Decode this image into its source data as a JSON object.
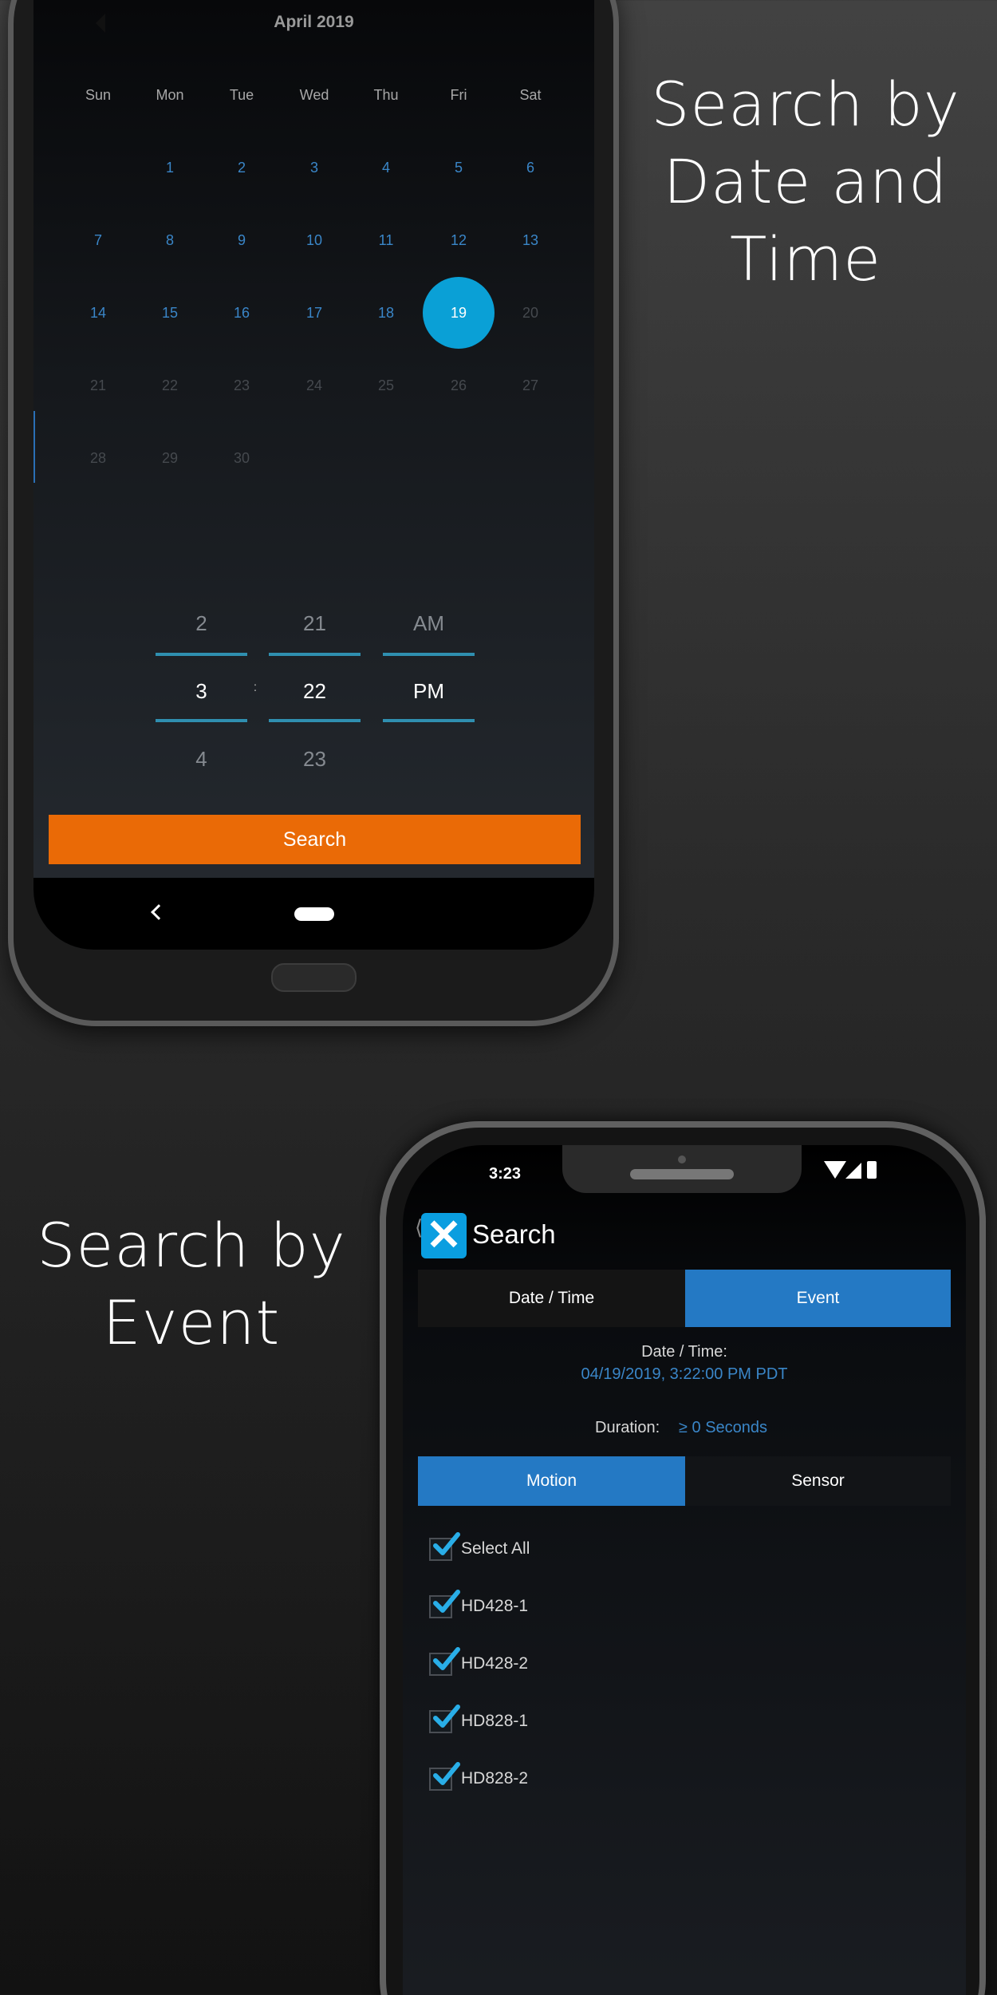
{
  "headlines": {
    "top": [
      "Search by",
      "Date and",
      "Time"
    ],
    "bottom": [
      "Search by",
      "Event"
    ]
  },
  "colors": {
    "accent": "#0aa0d6",
    "tab_active": "#2479c4",
    "search_button": "#ea6a06",
    "link_blue": "#3a86c8"
  },
  "calendar": {
    "month_label": "April 2019",
    "weekdays": [
      "Sun",
      "Mon",
      "Tue",
      "Wed",
      "Thu",
      "Fri",
      "Sat"
    ],
    "first_weekday": 1,
    "days_in_month": 30,
    "selected_day": 19,
    "last_enabled_day": 19
  },
  "time_picker": {
    "hour": {
      "prev": "2",
      "current": "3",
      "next": "4"
    },
    "separator": ":",
    "minute": {
      "prev": "21",
      "current": "22",
      "next": "23"
    },
    "ampm": {
      "prev": "AM",
      "current": "PM"
    }
  },
  "search_button": "Search",
  "event_screen": {
    "status_time": "3:23",
    "title": "Search",
    "tabs": [
      {
        "label": "Date / Time",
        "active": false
      },
      {
        "label": "Event",
        "active": true
      }
    ],
    "datetime_label": "Date / Time:",
    "datetime_value": "04/19/2019, 3:22:00 PM PDT",
    "duration_label": "Duration:",
    "duration_value": "≥ 0 Seconds",
    "type_tabs": [
      {
        "label": "Motion",
        "active": true
      },
      {
        "label": "Sensor",
        "active": false
      }
    ],
    "checkboxes": [
      {
        "label": "Select All",
        "checked": true
      },
      {
        "label": "HD428-1",
        "checked": true
      },
      {
        "label": "HD428-2",
        "checked": true
      },
      {
        "label": "HD828-1",
        "checked": true
      },
      {
        "label": "HD828-2",
        "checked": true
      }
    ]
  }
}
